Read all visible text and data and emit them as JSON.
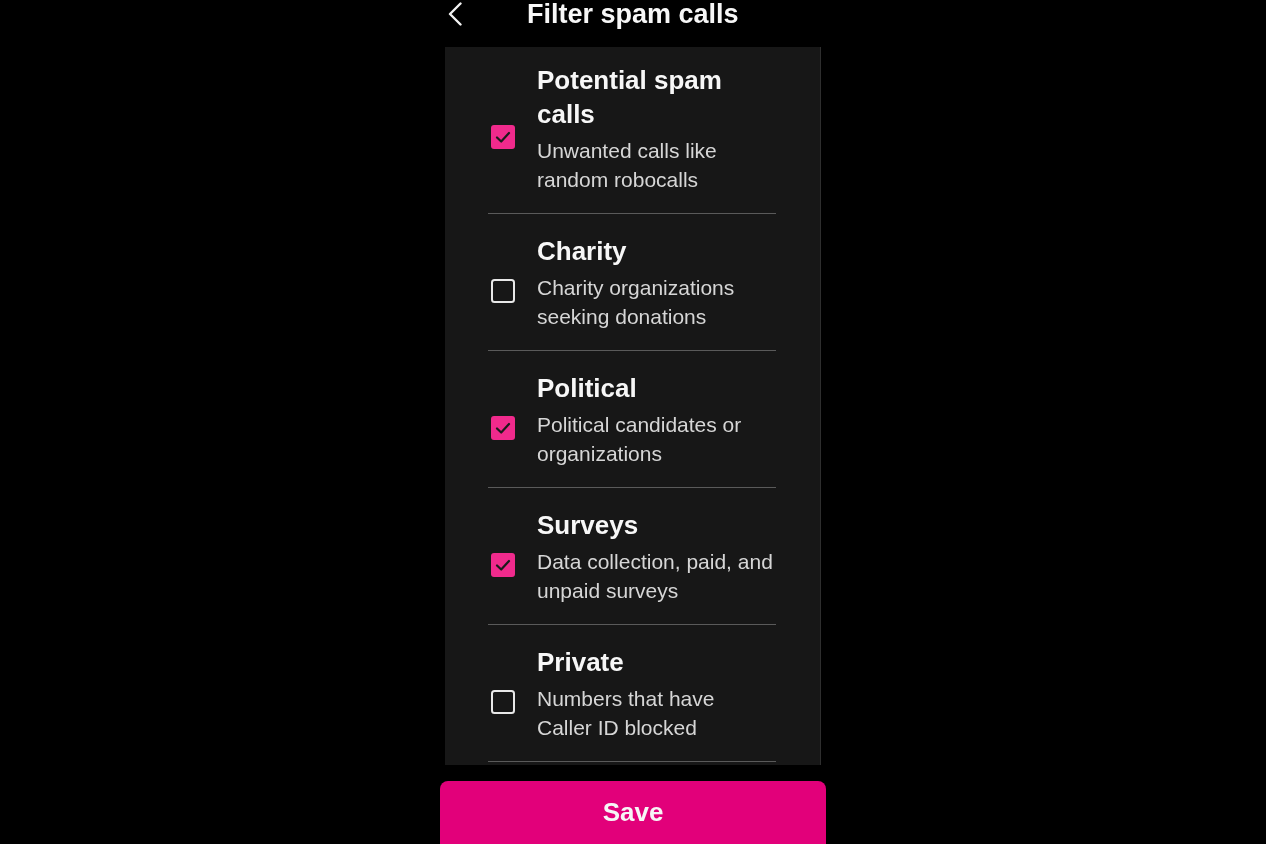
{
  "header": {
    "title": "Filter spam calls"
  },
  "filters": [
    {
      "title": "Potential spam calls",
      "description": "Unwanted calls like random robocalls",
      "checked": true
    },
    {
      "title": "Charity",
      "description": "Charity organizations seeking donations",
      "checked": false
    },
    {
      "title": "Political",
      "description": "Political candidates or organizations",
      "checked": true
    },
    {
      "title": "Surveys",
      "description": "Data collection, paid, and unpaid surveys",
      "checked": true
    },
    {
      "title": "Private",
      "description": "Numbers that have Caller ID blocked",
      "checked": false
    }
  ],
  "save_button": {
    "label": "Save"
  }
}
